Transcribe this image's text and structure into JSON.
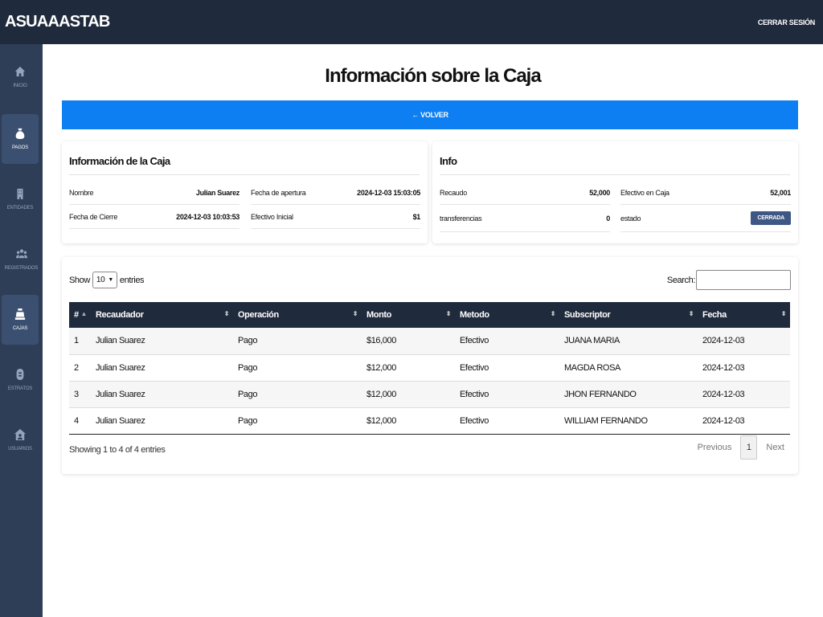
{
  "app": {
    "brand": "ASUAAASTAB",
    "logout_label": "CERRAR SESIÓN"
  },
  "sidebar": {
    "items": [
      {
        "label": "INICIO",
        "icon": "home-icon",
        "active": false
      },
      {
        "label": "PAGOS",
        "icon": "money-bag-icon",
        "active": true
      },
      {
        "label": "ENTIDADES",
        "icon": "building-icon",
        "active": false
      },
      {
        "label": "REGISTRADOS",
        "icon": "users-icon",
        "active": false
      },
      {
        "label": "CAJAS",
        "icon": "cash-register-icon",
        "active": true
      },
      {
        "label": "ESTRATOS",
        "icon": "layers-icon",
        "active": false
      },
      {
        "label": "USUARIOS",
        "icon": "user-house-icon",
        "active": false
      }
    ]
  },
  "page": {
    "title": "Información sobre la Caja",
    "back_label": "← VOLVER"
  },
  "caja_card": {
    "title": "Información de la Caja",
    "nombre_label": "Nombre",
    "nombre_value": "Julian Suarez",
    "apertura_label": "Fecha de apertura",
    "apertura_value": "2024-12-03 15:03:05",
    "cierre_label": "Fecha de Cierre",
    "cierre_value": "2024-12-03 10:03:53",
    "efectivo_inicial_label": "Efectivo Inicial",
    "efectivo_inicial_value": "$1"
  },
  "info_card": {
    "title": "Info",
    "recaudo_label": "Recaudo",
    "recaudo_value": "52,000",
    "efectivo_caja_label": "Efectivo en Caja",
    "efectivo_caja_value": "52,001",
    "transferencias_label": "transferencias",
    "transferencias_value": "0",
    "estado_label": "estado",
    "estado_value": "CERRADA"
  },
  "table": {
    "show_label": "Show",
    "entries_label": "entries",
    "page_size": "10",
    "search_label": "Search:",
    "columns": [
      "#",
      "Recaudador",
      "Operación",
      "Monto",
      "Metodo",
      "Subscriptor",
      "Fecha"
    ],
    "rows": [
      [
        "1",
        "Julian Suarez",
        "Pago",
        "$16,000",
        "Efectivo",
        "JUANA MARIA",
        "2024-12-03"
      ],
      [
        "2",
        "Julian Suarez",
        "Pago",
        "$12,000",
        "Efectivo",
        "MAGDA ROSA",
        "2024-12-03"
      ],
      [
        "3",
        "Julian Suarez",
        "Pago",
        "$12,000",
        "Efectivo",
        "JHON FERNANDO",
        "2024-12-03"
      ],
      [
        "4",
        "Julian Suarez",
        "Pago",
        "$12,000",
        "Efectivo",
        "WILLIAM FERNANDO",
        "2024-12-03"
      ]
    ],
    "info": "Showing 1 to 4 of 4 entries",
    "previous_label": "Previous",
    "next_label": "Next",
    "current_page": "1"
  },
  "colors": {
    "topbar": "#1f2a3c",
    "sidebar": "#2e3e57",
    "accent": "#0d7ff2",
    "badge": "#3e5784"
  }
}
